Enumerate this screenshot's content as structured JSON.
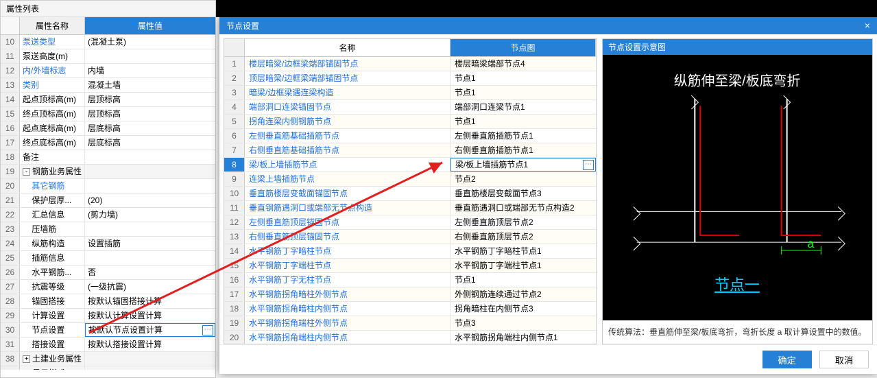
{
  "left": {
    "title": "属性列表",
    "header_name": "属性名称",
    "header_value": "属性值",
    "rows": [
      {
        "n": 10,
        "name": "泵送类型",
        "value": "(混凝土泵)",
        "blue": true
      },
      {
        "n": 11,
        "name": "泵送高度(m)",
        "value": ""
      },
      {
        "n": 12,
        "name": "内/外墙标志",
        "value": "内墙",
        "blue": true
      },
      {
        "n": 13,
        "name": "类别",
        "value": "混凝土墙",
        "blue": true
      },
      {
        "n": 14,
        "name": "起点顶标高(m)",
        "value": "层顶标高"
      },
      {
        "n": 15,
        "name": "终点顶标高(m)",
        "value": "层顶标高"
      },
      {
        "n": 16,
        "name": "起点底标高(m)",
        "value": "层底标高"
      },
      {
        "n": 17,
        "name": "终点底标高(m)",
        "value": "层底标高"
      },
      {
        "n": 18,
        "name": "备注",
        "value": ""
      },
      {
        "n": 19,
        "name": "钢筋业务属性",
        "value": "",
        "group": true,
        "exp": "-"
      },
      {
        "n": 20,
        "name": "其它钢筋",
        "value": "",
        "indent": 1,
        "blue": true
      },
      {
        "n": 21,
        "name": "保护层厚...",
        "value": "(20)",
        "indent": 1
      },
      {
        "n": 22,
        "name": "汇总信息",
        "value": "(剪力墙)",
        "indent": 1
      },
      {
        "n": 23,
        "name": "压墙筋",
        "value": "",
        "indent": 1
      },
      {
        "n": 24,
        "name": "纵筋构造",
        "value": "设置插筋",
        "indent": 1
      },
      {
        "n": 25,
        "name": "插筋信息",
        "value": "",
        "indent": 1
      },
      {
        "n": 26,
        "name": "水平钢筋...",
        "value": "否",
        "indent": 1
      },
      {
        "n": 27,
        "name": "抗震等级",
        "value": "(一级抗震)",
        "indent": 1
      },
      {
        "n": 28,
        "name": "锚固搭接",
        "value": "按默认锚固搭接计算",
        "indent": 1
      },
      {
        "n": 29,
        "name": "计算设置",
        "value": "按默认计算设置计算",
        "indent": 1
      },
      {
        "n": 30,
        "name": "节点设置",
        "value": "按默认节点设置计算",
        "indent": 1,
        "sel": true
      },
      {
        "n": 31,
        "name": "搭接设置",
        "value": "按默认搭接设置计算",
        "indent": 1
      },
      {
        "n": 38,
        "name": "土建业务属性",
        "value": "",
        "group": true,
        "exp": "+"
      },
      {
        "n": 39,
        "name": "显示样式",
        "value": "",
        "group": true,
        "exp": "+"
      }
    ]
  },
  "modal": {
    "title": "节点设置",
    "header_name": "名称",
    "header_map": "节点图",
    "rows": [
      {
        "n": 1,
        "name": "楼层暗梁/边框梁端部锚固节点",
        "map": "楼层暗梁端部节点4"
      },
      {
        "n": 2,
        "name": "顶层暗梁/边框梁端部锚固节点",
        "map": "节点1"
      },
      {
        "n": 3,
        "name": "暗梁/边框梁遇连梁构造",
        "map": "节点1"
      },
      {
        "n": 4,
        "name": "端部洞口连梁锚固节点",
        "map": "端部洞口连梁节点1"
      },
      {
        "n": 5,
        "name": "拐角连梁内侧钢筋节点",
        "map": "节点1"
      },
      {
        "n": 6,
        "name": "左侧垂直筋基础插筋节点",
        "map": "左侧垂直筋插筋节点1"
      },
      {
        "n": 7,
        "name": "右侧垂直筋基础插筋节点",
        "map": "右侧垂直筋插筋节点1"
      },
      {
        "n": 8,
        "name": "梁/板上墙插筋节点",
        "map": "梁/板上墙插筋节点1",
        "sel": true
      },
      {
        "n": 9,
        "name": "连梁上墙插筋节点",
        "map": "节点2"
      },
      {
        "n": 10,
        "name": "垂直筋楼层变截面锚固节点",
        "map": "垂直筋楼层变截面节点3"
      },
      {
        "n": 11,
        "name": "垂直钢筋遇洞口或端部无节点构造",
        "map": "垂直筋遇洞口或端部无节点构造2"
      },
      {
        "n": 12,
        "name": "左侧垂直筋顶层锚固节点",
        "map": "左侧垂直筋顶层节点2"
      },
      {
        "n": 13,
        "name": "右侧垂直筋顶层锚固节点",
        "map": "右侧垂直筋顶层节点2"
      },
      {
        "n": 14,
        "name": "水平钢筋丁字暗柱节点",
        "map": "水平钢筋丁字暗柱节点1"
      },
      {
        "n": 15,
        "name": "水平钢筋丁字端柱节点",
        "map": "水平钢筋丁字端柱节点1"
      },
      {
        "n": 16,
        "name": "水平钢筋丁字无柱节点",
        "map": "节点1"
      },
      {
        "n": 17,
        "name": "水平钢筋拐角暗柱外侧节点",
        "map": "外侧钢筋连续通过节点2"
      },
      {
        "n": 18,
        "name": "水平钢筋拐角暗柱内侧节点",
        "map": "拐角暗柱在内侧节点3"
      },
      {
        "n": 19,
        "name": "水平钢筋拐角端柱外侧节点",
        "map": "节点3"
      },
      {
        "n": 20,
        "name": "水平钢筋拐角端柱内侧节点",
        "map": "水平钢筋拐角端柱内侧节点1"
      }
    ],
    "preview_title": "节点设置示意图",
    "svg_title": "纵筋伸至梁/板底弯折",
    "svg_label_a": "a",
    "svg_label_node": "节点一",
    "caption": "传统算法：垂直筋伸至梁/板底弯折，弯折长度 a 取计算设置中的数值。",
    "ok": "确定",
    "cancel": "取消"
  }
}
